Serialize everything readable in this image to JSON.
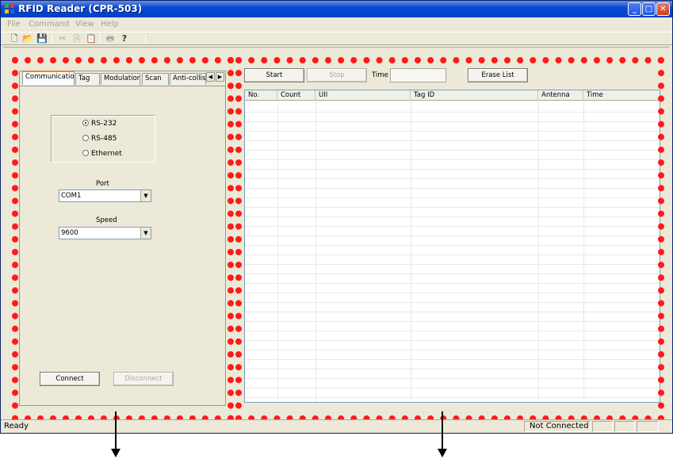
{
  "window": {
    "title": "RFID Reader (CPR-503)",
    "minimize": "_",
    "maximize": "□",
    "close": "✕"
  },
  "menu": [
    "File",
    "Command",
    "View",
    "Help"
  ],
  "toolbar": {
    "new": "🗋",
    "open": "📂",
    "save": "💾",
    "cut": "✂",
    "copy": "⎘",
    "paste": "📋",
    "print": "🖶",
    "help": "?"
  },
  "tabs": [
    "Communication",
    "Tag",
    "Modulation",
    "Scan",
    "Anti-collisi"
  ],
  "tab_arrows": {
    "left": "◀",
    "right": "▶"
  },
  "communication": {
    "radios": [
      {
        "label": "RS-232",
        "checked": true
      },
      {
        "label": "RS-485",
        "checked": false
      },
      {
        "label": "Ethernet",
        "checked": false
      }
    ],
    "port_label": "Port",
    "port_value": "COM1",
    "speed_label": "Speed",
    "speed_value": "9600",
    "connect_label": "Connect",
    "disconnect_label": "Disconnect",
    "combo_arrow": "▼"
  },
  "scan": {
    "start_label": "Start",
    "stop_label": "Stop",
    "time_label": "Time",
    "erase_label": "Erase List"
  },
  "list": {
    "columns": [
      "No.",
      "Count",
      "UII",
      "Tag ID",
      "Antenna",
      "Time"
    ]
  },
  "status": {
    "text": "Ready",
    "connection": "Not Connected"
  },
  "colors": {
    "annotation": "#ff1a1a",
    "titlebar": "#0a49d8"
  }
}
